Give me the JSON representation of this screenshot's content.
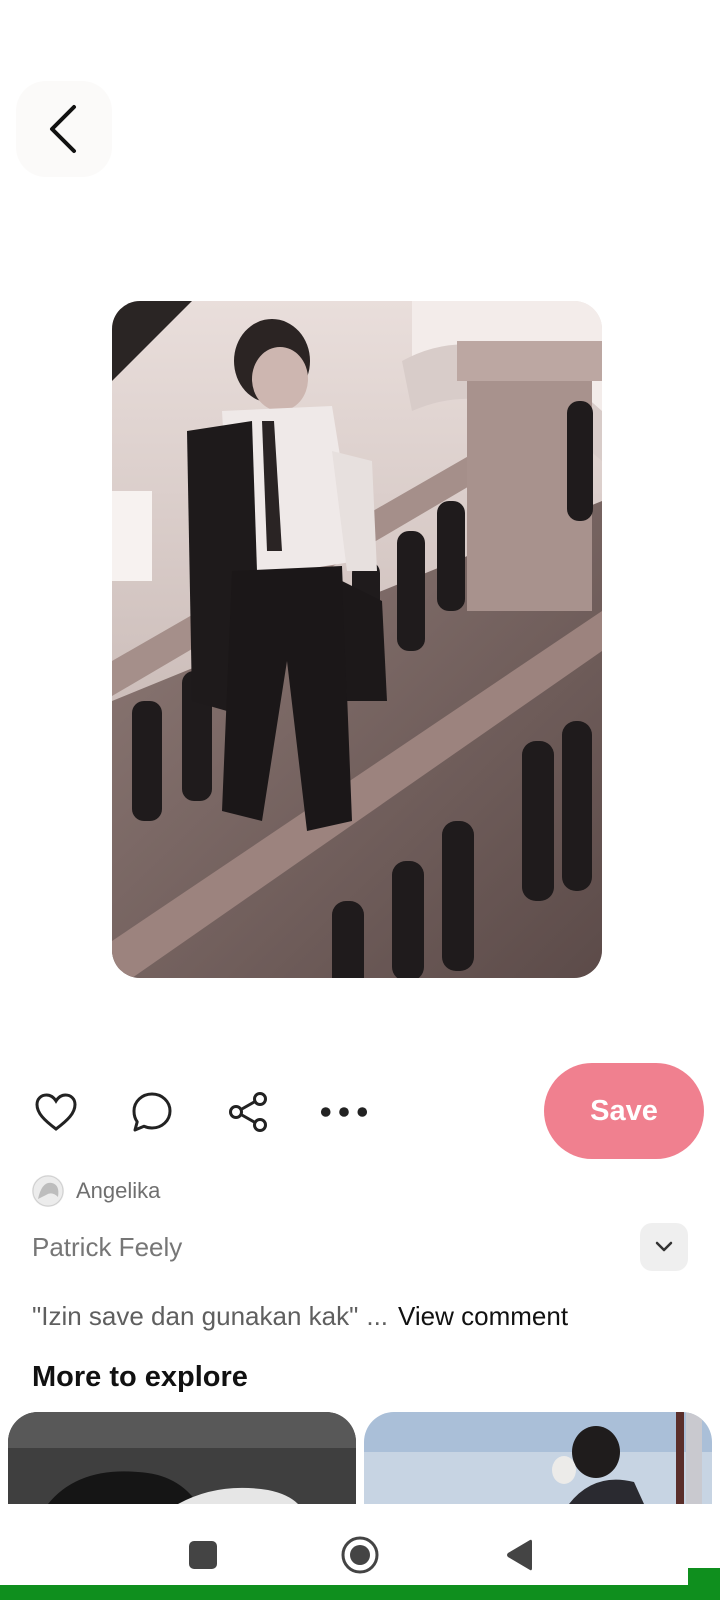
{
  "header": {
    "back_icon": "chevron-left-icon"
  },
  "pin": {
    "image_alt": "Man in white shirt and striped tie descending a stone staircase"
  },
  "actions": {
    "like_icon": "heart-icon",
    "comment_icon": "comment-bubble-icon",
    "share_icon": "share-icon",
    "more_icon": "more-dots-icon",
    "save_label": "Save",
    "save_color": "#f0808f"
  },
  "author": {
    "name": "Angelika"
  },
  "details": {
    "title": "Patrick Feely",
    "expand_icon": "chevron-down-icon"
  },
  "comment": {
    "text": "\"Izin save dan gunakan kak\"",
    "ellipsis": "...",
    "view_label": "View comment"
  },
  "explore": {
    "heading": "More to explore"
  },
  "nav": {
    "recents_icon": "square-icon",
    "home_icon": "circle-home-icon",
    "back_icon": "triangle-back-icon"
  }
}
